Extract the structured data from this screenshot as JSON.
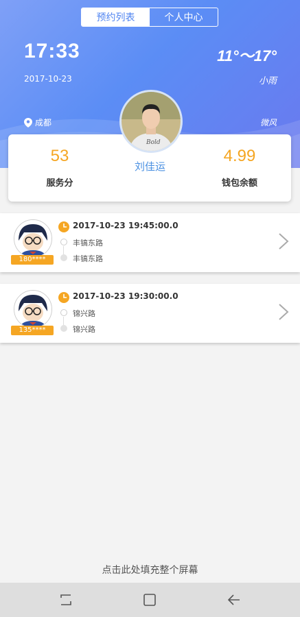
{
  "tabs": [
    {
      "label": "预约列表",
      "active": true
    },
    {
      "label": "个人中心",
      "active": false
    }
  ],
  "header": {
    "time": "17:33",
    "temperature": "11°～17°",
    "date": "2017-10-23",
    "weather": "小雨",
    "city": "成都",
    "wind": "微风"
  },
  "profile": {
    "name": "刘佳运",
    "score": "53",
    "score_label": "服务分",
    "balance": "4.99",
    "balance_label": "钱包余额"
  },
  "orders": [
    {
      "phone": "180****",
      "time": "2017-10-23 19:45:00.0",
      "from": "丰镐东路",
      "to": "丰镐东路"
    },
    {
      "phone": "135****",
      "time": "2017-10-23 19:30:00.0",
      "from": "锦兴路",
      "to": "锦兴路"
    }
  ],
  "fill_screen_label": "点击此处填充整个屏幕",
  "colors": {
    "accent": "#4f84f1",
    "orange": "#f5a623",
    "name_blue": "#4a90e2"
  },
  "icons": [
    "location-pin-icon",
    "clock-icon",
    "chevron-right-icon",
    "recent-apps-icon",
    "home-icon",
    "back-icon"
  ]
}
